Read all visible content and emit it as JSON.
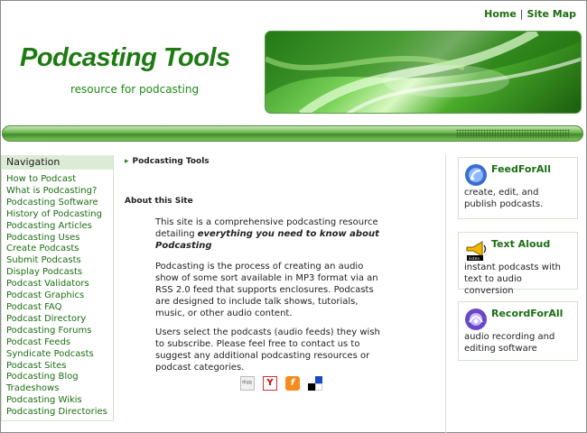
{
  "topnav": {
    "home": "Home",
    "separator": "|",
    "sitemap": "Site Map"
  },
  "header": {
    "title": "Podcasting Tools",
    "tagline": "resource for podcasting"
  },
  "sidebar": {
    "heading": "Navigation",
    "items": [
      "How to Podcast",
      "What is Podcasting?",
      "Podcasting Software",
      "History of Podcasting",
      "Podcasting Articles",
      "Podcasting Uses",
      "Create Podcasts",
      "Submit Podcasts",
      "Display Podcasts",
      "Podcast Validators",
      "Podcast Graphics",
      "Podcast FAQ",
      "Podcast Directory",
      "Podcasting Forums",
      "Podcast Feeds",
      "Syndicate Podcasts",
      "Podcast Sites",
      "Podcasting Blog",
      "Tradeshows",
      "Podcasting Wikis",
      "Podcasting Directories"
    ]
  },
  "main": {
    "breadcrumb": "Podcasting Tools",
    "section_heading": "About this Site",
    "p1_plain": "This site is a comprehensive podcasting resource detailing ",
    "p1_emphasis": "everything you need to know about Podcasting",
    "p2": "Podcasting is the process of creating an audio show of some sort available in MP3 format via an RSS 2.0 feed that supports enclosures. Podcasts are designed to include talk shows, tutorials, music, or other audio content.",
    "p3": "Users select the podcasts (audio feeds) they wish to subscribe. Please feel free to contact us to suggest any additional podcasting resources or podcast categories.",
    "social_icons": [
      "digg-icon",
      "yahoo-icon",
      "furl-icon",
      "delicious-icon"
    ]
  },
  "products": [
    {
      "name": "FeedForAll",
      "description": "create, edit, and publish podcasts.",
      "icon": "feed-icon"
    },
    {
      "name": "Text Aloud",
      "description": "instant podcasts with text to audio conversion",
      "icon": "megaphone-icon"
    },
    {
      "name": "RecordForAll",
      "description": "audio recording and editing software",
      "icon": "record-icon"
    }
  ],
  "colors": {
    "accent_green": "#1e7a12",
    "link_green": "#1b6e12",
    "nav_header_bg": "#dcebd5"
  }
}
